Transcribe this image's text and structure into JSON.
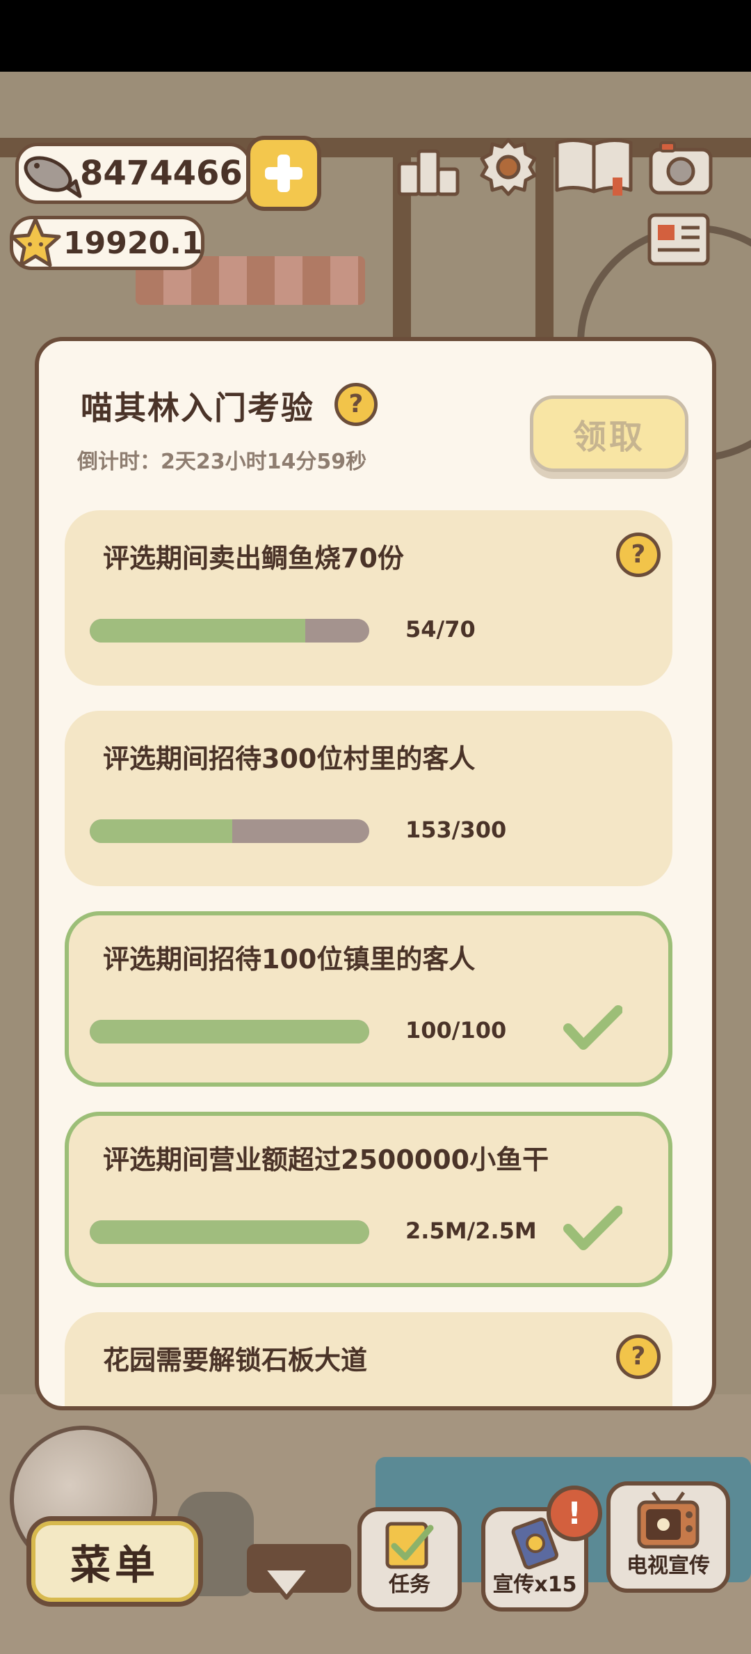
{
  "hud": {
    "fish_currency": "8474466",
    "star_currency": "19920.1"
  },
  "icons": {
    "fish": "fish-icon",
    "star": "star-icon",
    "plus": "plus-icon",
    "ranking": "ranking-icon",
    "settings": "gear-icon",
    "book": "book-icon",
    "camera": "camera-icon",
    "newspaper": "newspaper-icon",
    "help": "question-icon",
    "check": "checkmark-icon",
    "tv": "tv-icon"
  },
  "modal": {
    "title": "喵其林入门考验",
    "help_symbol": "?",
    "countdown": "倒计时：2天23小时14分59秒",
    "claim_label": "领取",
    "tasks": [
      {
        "text": "评选期间卖出鲷鱼烧70份",
        "progress_text": "54/70",
        "progress": 0.771,
        "done": false,
        "has_help": true
      },
      {
        "text": "评选期间招待300位村里的客人",
        "progress_text": "153/300",
        "progress": 0.51,
        "done": false,
        "has_help": false
      },
      {
        "text": "评选期间招待100位镇里的客人",
        "progress_text": "100/100",
        "progress": 1.0,
        "done": true,
        "has_help": false
      },
      {
        "text": "评选期间营业额超过2500000小鱼干",
        "progress_text": "2.5M/2.5M",
        "progress": 1.0,
        "done": true,
        "has_help": false
      },
      {
        "text": "花园需要解锁石板大道",
        "progress_text": "",
        "progress": 0,
        "done": false,
        "has_help": true
      }
    ]
  },
  "bottom": {
    "menu_label": "菜单",
    "task_label": "任务",
    "promo_label": "宣传x15",
    "tv_label": "电视宣传",
    "alert_symbol": "!"
  },
  "colors": {
    "accent_yellow": "#f2c44a",
    "progress_green": "#a0bd7e",
    "progress_track": "#a4938e",
    "card_bg": "#f4e6c6",
    "outline_brown": "#6b4d3a"
  }
}
